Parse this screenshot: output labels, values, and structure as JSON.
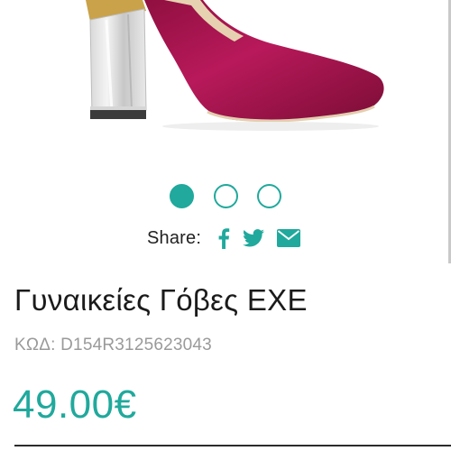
{
  "product": {
    "image_alt": "Burgundy velvet pump with clear block heel",
    "title": "Γυναικείες Γόβες EXE",
    "code_label": "ΚΩΔ:",
    "code_value": "D154R3125623043",
    "price": "49.00€"
  },
  "carousel": {
    "dots": [
      {
        "active": true
      },
      {
        "active": false
      },
      {
        "active": false
      }
    ]
  },
  "share": {
    "label": "Share:",
    "icons": [
      "facebook-icon",
      "twitter-icon",
      "email-icon"
    ]
  },
  "colors": {
    "accent": "#20a99c",
    "shoe": "#b1164f",
    "text": "#1b1b1b",
    "muted": "#9a9a9a"
  }
}
